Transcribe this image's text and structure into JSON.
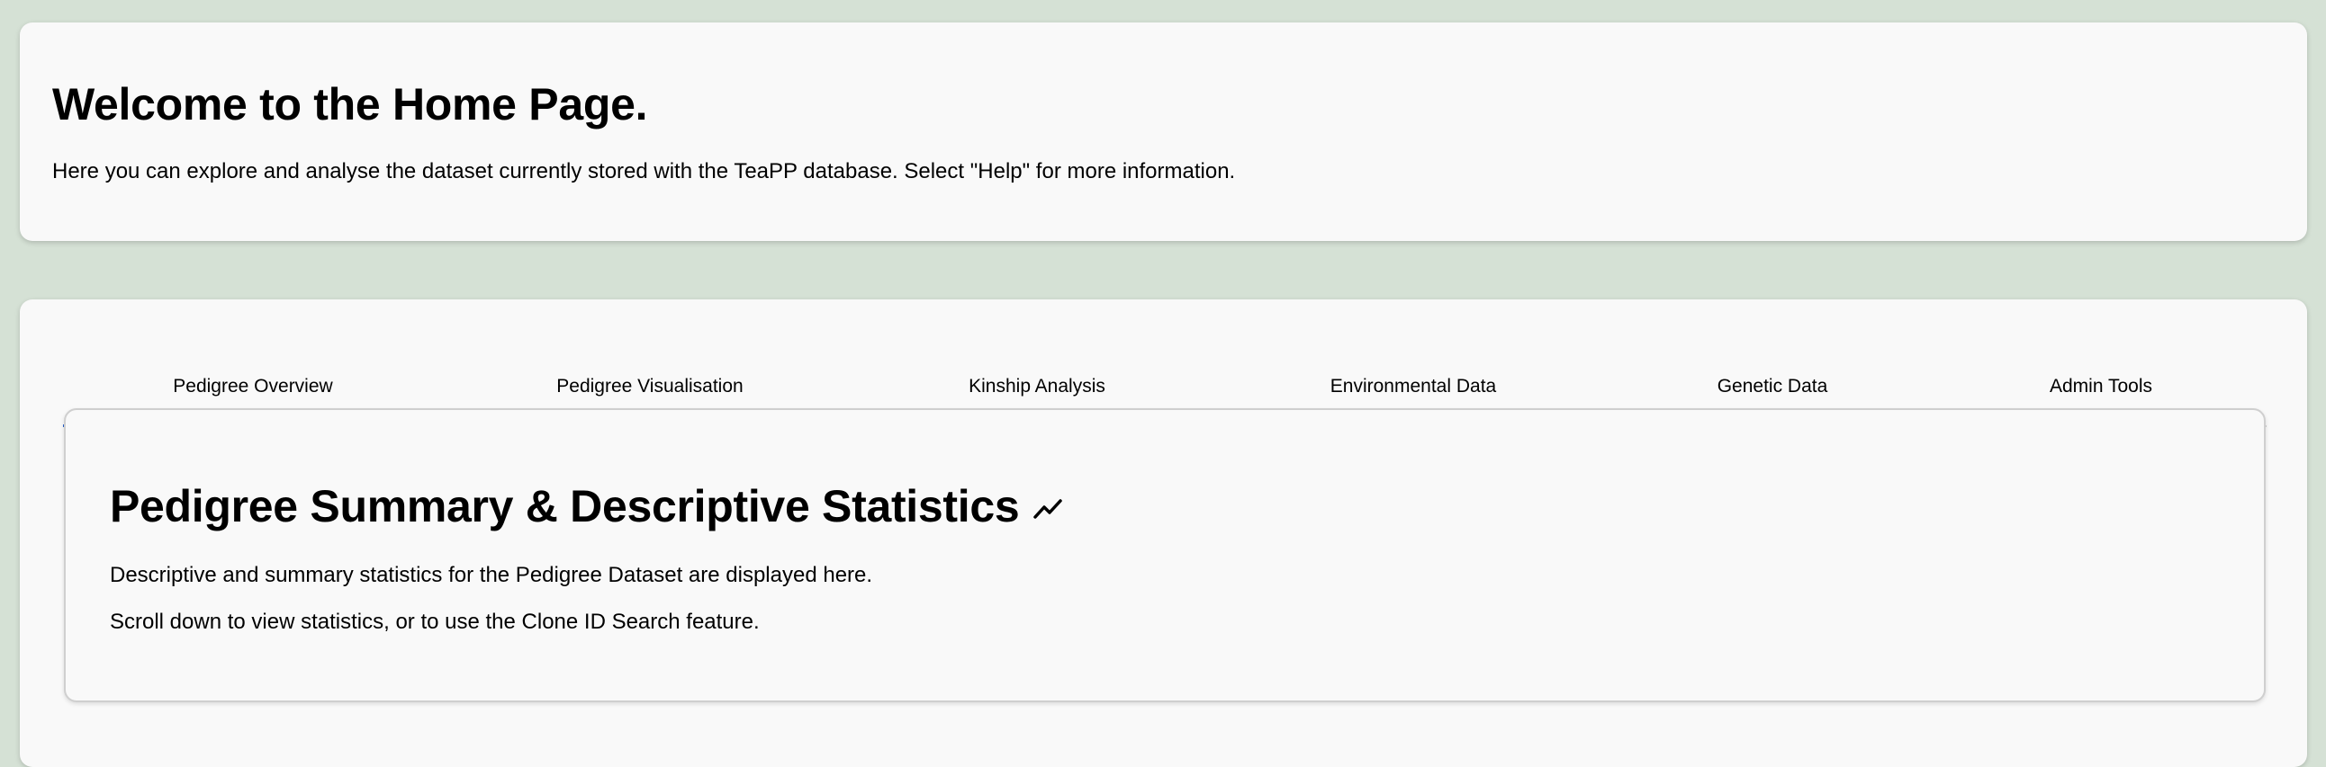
{
  "welcome": {
    "title": "Welcome to the Home Page.",
    "description": "Here you can explore and analyse the dataset currently stored with the TeaPP database. Select \"Help\" for more information."
  },
  "tabs": [
    {
      "label": "Pedigree Overview",
      "active": true
    },
    {
      "label": "Pedigree Visualisation",
      "active": false
    },
    {
      "label": "Kinship Analysis",
      "active": false
    },
    {
      "label": "Environmental Data",
      "active": false
    },
    {
      "label": "Genetic Data",
      "active": false
    },
    {
      "label": "Admin Tools",
      "active": false
    }
  ],
  "panel": {
    "title": "Pedigree Summary & Descriptive Statistics",
    "title_icon": "trending-up-icon",
    "description_1": "Descriptive and summary statistics for the Pedigree Dataset are displayed here.",
    "description_2": "Scroll down to view statistics, or to use the Clone ID Search feature."
  },
  "colors": {
    "background": "#d5e1d5",
    "card": "#f9f9f9",
    "active_tab_indicator": "#2a62c9"
  }
}
